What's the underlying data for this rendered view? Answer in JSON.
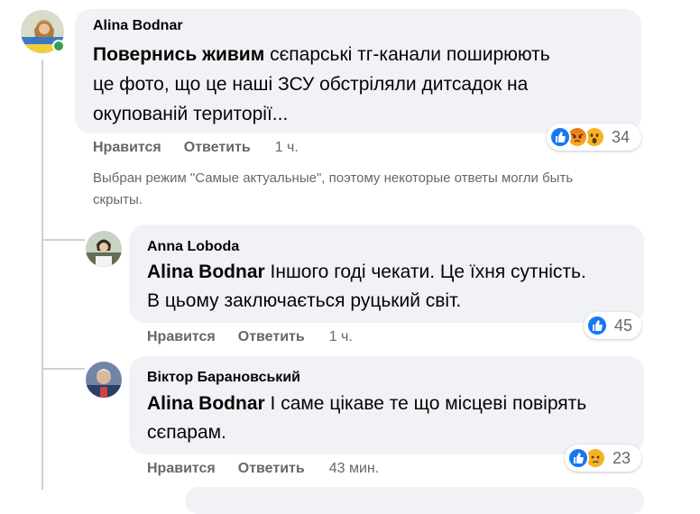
{
  "comments": [
    {
      "author": "Alina Bodnar",
      "text_bold": "Повернись живим",
      "text_line1": " сєпарські тг-канали поширюють",
      "text_line2": "це фото, що це наші ЗСУ обстріляли дитсадок на",
      "text_line3": "окупованій території...",
      "like_label": "Нравится",
      "reply_label": "Ответить",
      "time": "1 ч.",
      "reaction_count": "34",
      "reactions": [
        "like-icon",
        "angry-icon",
        "wow-icon"
      ]
    },
    {
      "author": "Anna Loboda",
      "mention": "Alina Bodnar",
      "text_line1": " Іншого годі чекати. Це їхня сутність.",
      "text_line2": "В цьому заключається руцький світ.",
      "like_label": "Нравится",
      "reply_label": "Ответить",
      "time": "1 ч.",
      "reaction_count": "45",
      "reactions": [
        "like-icon"
      ]
    },
    {
      "author": "Віктор Барановський",
      "mention": "Alina Bodnar",
      "text_line1": " І саме цікаве те що місцеві повірять",
      "text_line2": "сєпарам.",
      "like_label": "Нравится",
      "reply_label": "Ответить",
      "time": "43 мин.",
      "reaction_count": "23",
      "reactions": [
        "like-icon",
        "sad-icon"
      ]
    }
  ],
  "notice_line1": "Выбран режим \"Самые актуальные\", поэтому некоторые ответы могли быть",
  "notice_line2": "скрыты.",
  "colors": {
    "bubble": "#f0f2f5",
    "secondary_text": "#65676b",
    "like_blue": "#1877f2",
    "online_green": "#31a24c"
  }
}
